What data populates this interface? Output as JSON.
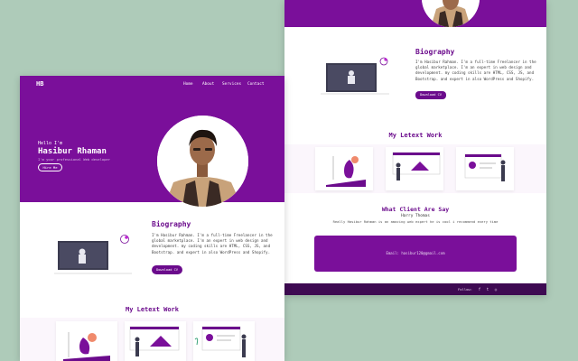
{
  "colors": {
    "background": "#aecbb9",
    "brand_purple": "#7a0f9a",
    "heading_purple": "#6b0b8c",
    "footer_dark": "#3e0a52"
  },
  "left_page": {
    "logo": "HB",
    "nav": [
      "Home",
      "About",
      "Services",
      "Contact"
    ],
    "hero": {
      "greeting": "Hello I'm",
      "name": "Hasibur Rhaman",
      "subtitle": "I'm your professional Web developer",
      "hire_button": "Hire Me"
    },
    "bio": {
      "title": "Biography",
      "text": "I'm Hasibur Rahman. I'm a full-time Freelancer in the global marketplace. I'm an expert in web design and development. my coding skills are HTML, CSS, JS, and Bootstrap. and expert in also WordPress and Shopify.",
      "button": "Download CV"
    },
    "work_title": "My Letext Work"
  },
  "right_page": {
    "bio": {
      "title": "Biography",
      "text": "I'm Hasibur Rahman. I'm a full-time Freelancer in the global marketplace. I'm an expert in web design and development. my coding skills are HTML, CSS, JS, and Bootstrap. and expert in also WordPress and Shopify.",
      "button": "Download CV"
    },
    "work_title": "My Letext Work",
    "testimonial": {
      "title": "What Client Are Say",
      "name": "Harry Thomas",
      "quote": "Really Hasibur Rahman is an amazing web expert he is cool i recommend every time"
    },
    "contact": {
      "email_line": "Email: hasibur120@gmail.com"
    },
    "footer": {
      "follow": "Follow:",
      "social_icons": [
        "facebook-icon",
        "twitter-icon",
        "instagram-icon"
      ],
      "social_glyphs": [
        "f",
        "t",
        "◎"
      ]
    }
  }
}
